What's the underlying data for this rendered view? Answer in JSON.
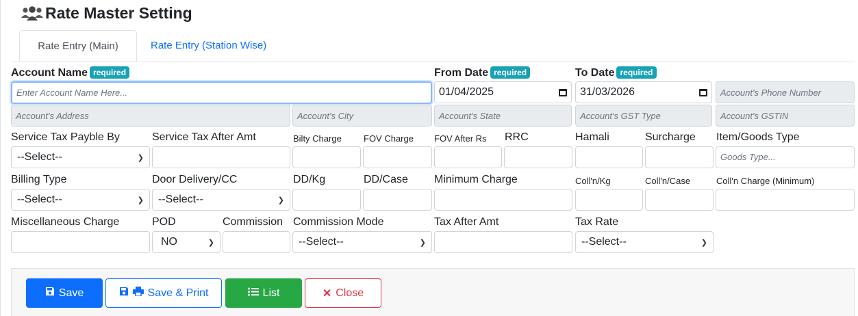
{
  "page": {
    "title": "Rate Master Setting"
  },
  "tabs": {
    "main": "Rate Entry (Main)",
    "station": "Rate Entry (Station Wise)"
  },
  "labels": {
    "account_name": "Account Name",
    "required": "required",
    "from_date": "From Date",
    "to_date": "To Date",
    "service_tax_payble_by": "Service Tax Payble By",
    "service_tax_after_amt": "Service Tax After Amt",
    "bilty_charge": "Bilty Charge",
    "fov_charge": "FOV Charge",
    "fov_after_rs": "FOV After Rs",
    "rrc": "RRC",
    "hamali": "Hamali",
    "surcharge": "Surcharge",
    "item_goods_type": "Item/Goods Type",
    "billing_type": "Billing Type",
    "door_delivery_cc": "Door Delivery/CC",
    "dd_kg": "DD/Kg",
    "dd_case": "DD/Case",
    "minimum_charge": "Minimum Charge",
    "colln_kg": "Coll'n/Kg",
    "colln_case": "Coll'n/Case",
    "colln_charge_min": "Coll'n Charge (Minimum)",
    "misc_charge": "Miscellaneous Charge",
    "pod": "POD",
    "commission": "Commission",
    "commission_mode": "Commission Mode",
    "tax_after_amt": "Tax After Amt",
    "tax_rate": "Tax Rate"
  },
  "fields": {
    "account_name_placeholder": "Enter Account Name Here...",
    "from_date_value": "01/04/2025",
    "to_date_value": "31/03/2026",
    "phone_placeholder": "Account's Phone Number",
    "address_placeholder": "Account's Address",
    "city_placeholder": "Account's City",
    "state_placeholder": "Account's State",
    "gst_type_placeholder": "Account's GST Type",
    "gstin_placeholder": "Account's GSTIN",
    "goods_type_placeholder": "Goods Type...",
    "select_default": "--Select--",
    "pod_value": "NO"
  },
  "buttons": {
    "save": "Save",
    "save_print": "Save & Print",
    "list": "List",
    "close": "Close"
  },
  "colors": {
    "primary": "#0d6efd",
    "success": "#28a745",
    "danger": "#dc3545",
    "badge": "#17a2b8"
  },
  "icons": [
    "users-icon",
    "save-icon",
    "print-icon",
    "list-icon",
    "close-icon",
    "calendar-icon",
    "chevron-down-icon"
  ]
}
